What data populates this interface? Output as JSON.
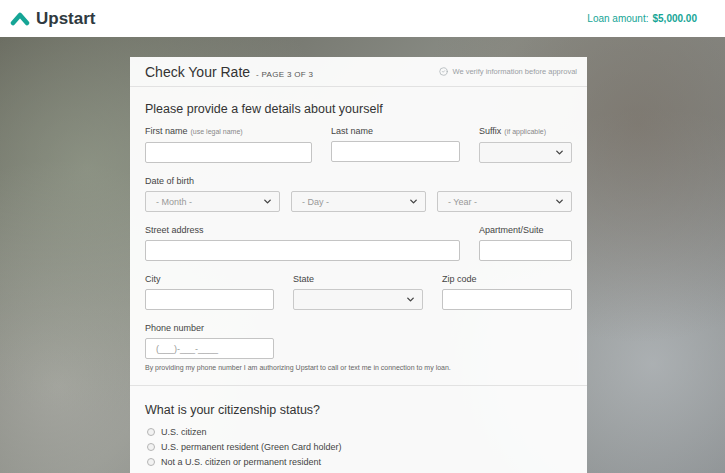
{
  "header": {
    "logo": "Upstart",
    "loan_label": "Loan amount:",
    "loan_value": "$5,000.00"
  },
  "card": {
    "title": "Check Your Rate",
    "page": "- PAGE 3 OF 3",
    "verify": "We verify information before approval"
  },
  "details": {
    "title": "Please provide a few details about yourself",
    "rows": [
      {
        "groups": [
          {
            "label": "First name",
            "hint": "(use legal name)",
            "controls": [
              {
                "kind": "text"
              }
            ]
          },
          {
            "label": "Last name",
            "controls": [
              {
                "kind": "text"
              }
            ]
          },
          {
            "label": "Suffix",
            "hint": "(if applicable)",
            "controls": [
              {
                "kind": "select"
              }
            ]
          }
        ]
      },
      {
        "groups": [
          {
            "label": "Date of birth",
            "controls": [
              {
                "kind": "select",
                "value": "- Month -"
              },
              {
                "kind": "select",
                "value": "- Day -"
              },
              {
                "kind": "select",
                "value": "- Year -"
              }
            ]
          }
        ]
      },
      {
        "groups": [
          {
            "label": "Street address",
            "controls": [
              {
                "kind": "text"
              }
            ]
          },
          {
            "label": "Apartment/Suite",
            "controls": [
              {
                "kind": "text"
              }
            ]
          }
        ]
      },
      {
        "groups": [
          {
            "label": "City",
            "controls": [
              {
                "kind": "text"
              }
            ]
          },
          {
            "label": "State",
            "controls": [
              {
                "kind": "select"
              }
            ]
          },
          {
            "label": "Zip code",
            "controls": [
              {
                "kind": "text"
              }
            ]
          }
        ]
      },
      {
        "groups": [
          {
            "label": "Phone number",
            "controls": [
              {
                "kind": "text",
                "placeholder": "(___)-___-____"
              }
            ]
          }
        ]
      }
    ],
    "disclaimer": "By providing my phone number I am authorizing Upstart to call or text me in connection to my loan."
  },
  "citizenship": {
    "title": "What is your citizenship status?",
    "options": [
      {
        "label": "U.S. citizen",
        "selected": false
      },
      {
        "label": "U.S. permanent resident (Green Card holder)",
        "selected": false
      },
      {
        "label": "Not a U.S. citizen or permanent resident",
        "selected": false
      }
    ]
  }
}
